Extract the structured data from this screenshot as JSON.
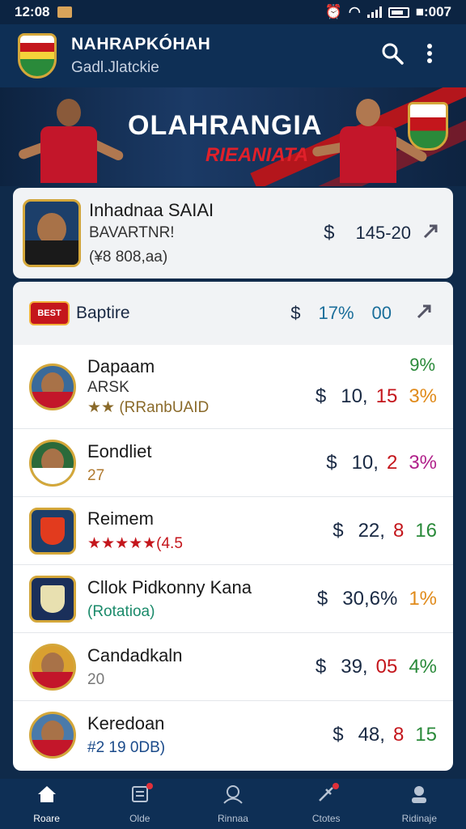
{
  "status_bar": {
    "time": "12:08",
    "battery_text": "■:007"
  },
  "header": {
    "title": "NAHRAPKÓHAH",
    "subtitle": "Gadl.Jlatckie"
  },
  "banner": {
    "title": "OLAHRANGIA",
    "subtitle": "RIEANIATA"
  },
  "featured": {
    "name": "Inhadnaa SAIAI",
    "sub": "BAVARTNR!",
    "detail": "(¥8 808,aa)",
    "dollar": "$",
    "price": "145-20"
  },
  "section": {
    "badge": "BEST",
    "label": "Baptire",
    "dollar": "$",
    "price_a": "17%",
    "price_b": "00"
  },
  "top_pct": "9%",
  "rows": [
    {
      "name": "Dapaam",
      "sub1": "ARSK",
      "sub2": "★★ (RRanbUAID",
      "v1": "10,",
      "v2": "15",
      "v3": "3%",
      "v2_color": "#c4161c",
      "v3_color": "#e08a1a",
      "sub_color": "#8a6a2a",
      "badge": "R"
    },
    {
      "name": "Eondliet",
      "sub": "27",
      "v1": "10,",
      "v2": "2",
      "v3": "3%",
      "v2_color": "#c4161c",
      "v3_color": "#b0208a",
      "sub_color": "#b07a30",
      "badge": "7"
    },
    {
      "name": "Reimem",
      "sub": "★★★★★(4.5",
      "v1": "22,",
      "v2": "8",
      "v3": "16",
      "v2_color": "#c4161c",
      "v3_color": "#2a8a3a",
      "sub_color": "#c4161c",
      "badge": "★"
    },
    {
      "name": "Cllok Pidkonny Kana",
      "sub": "(Rotatioa)",
      "v1": "30,6%",
      "v2": "",
      "v3": "1%",
      "v2_color": "#c4161c",
      "v3_color": "#e08a1a",
      "sub_color": "#1a8a6a",
      "badge": "e"
    },
    {
      "name": "Candadkaln",
      "sub": "20",
      "v1": "39,",
      "v2": "05",
      "v3": "4%",
      "v2_color": "#c4161c",
      "v3_color": "#2a8a3a",
      "sub_color": "#777",
      "badge": "G"
    },
    {
      "name": "Keredoan",
      "sub": "#2 19 0DB)",
      "v1": "48,",
      "v2": "8",
      "v3": "15",
      "v2_color": "#c4161c",
      "v3_color": "#2a8a3a",
      "sub_color": "#1a4a8a",
      "badge": "5"
    }
  ],
  "dollar": "$",
  "nav": [
    {
      "label": "Roare",
      "icon": "home-icon"
    },
    {
      "label": "Olde",
      "icon": "note-icon"
    },
    {
      "label": "Rinnaa",
      "icon": "person-outline-icon"
    },
    {
      "label": "Ctotes",
      "icon": "tool-icon"
    },
    {
      "label": "Ridinaje",
      "icon": "profile-icon"
    }
  ]
}
